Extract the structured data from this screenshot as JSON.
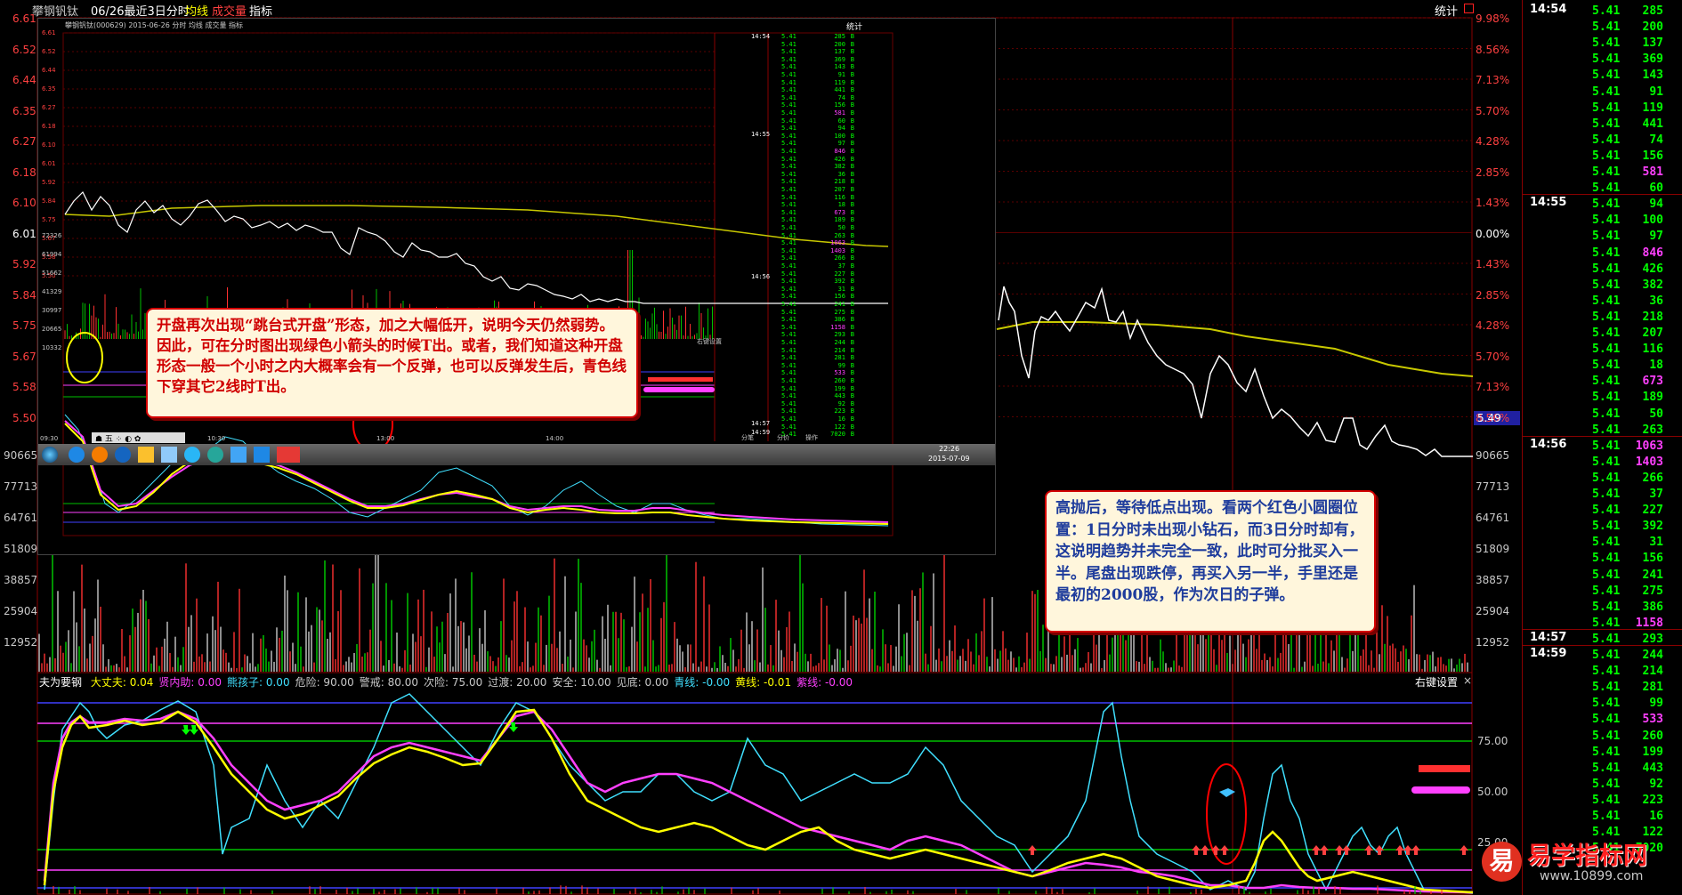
{
  "titlebar": {
    "stock_name": "攀钢钒钛",
    "period": "06/26最近3日分时",
    "ma_label": "均线",
    "vol_label": "成交量",
    "indicator_label": "指标",
    "stats_label": "统计"
  },
  "left_axis": [
    "6.61",
    "6.52",
    "6.44",
    "6.35",
    "6.27",
    "6.18",
    "6.10",
    "6.01",
    "5.92",
    "5.84",
    "5.75",
    "5.67",
    "5.58",
    "5.50"
  ],
  "left_vol_axis": [
    "90665",
    "77713",
    "64761",
    "51809",
    "38857",
    "25904",
    "12952"
  ],
  "right_axis": [
    "9.98%",
    "8.56%",
    "7.13%",
    "5.70%",
    "4.28%",
    "2.85%",
    "1.43%",
    "0.00%",
    "1.43%",
    "2.85%",
    "4.28%",
    "5.70%",
    "7.13%",
    "8.56%"
  ],
  "right_vol_axis": [
    "90665",
    "77713",
    "64761",
    "51809",
    "38857",
    "25904",
    "12952"
  ],
  "current_price_tag": "5.49",
  "right_indicator_axis": [
    "75.00",
    "50.00",
    "25.00"
  ],
  "indicator_bar": {
    "name": "夫为要钢",
    "items": [
      {
        "label": "大丈夫:",
        "value": "0.04",
        "color": "#ffff00"
      },
      {
        "label": "贤内助:",
        "value": "0.00",
        "color": "#ff40ff"
      },
      {
        "label": "熊孩子:",
        "value": "0.00",
        "color": "#40e0ff"
      },
      {
        "label": "危险:",
        "value": "90.00",
        "color": "#c8c8c8"
      },
      {
        "label": "警戒:",
        "value": "80.00",
        "color": "#c8c8c8"
      },
      {
        "label": "次险:",
        "value": "75.00",
        "color": "#c8c8c8"
      },
      {
        "label": "过渡:",
        "value": "20.00",
        "color": "#c8c8c8"
      },
      {
        "label": "安全:",
        "value": "10.00",
        "color": "#c8c8c8"
      },
      {
        "label": "见底:",
        "value": "0.00",
        "color": "#c8c8c8"
      },
      {
        "label": "青线:",
        "value": "-0.00",
        "color": "#40e0ff"
      },
      {
        "label": "黄线:",
        "value": "-0.01",
        "color": "#ffff00"
      },
      {
        "label": "紫线:",
        "value": "-0.00",
        "color": "#ff40ff"
      }
    ],
    "settings_label": "右键设置",
    "close_label": "×"
  },
  "callout1": "开盘再次出现“跳台式开盘”形态，加之大幅低开，说明今天仍然弱势。因此，可在分时图出现绿色小箭头的时候T出。或者，我们知道这种开盘形态一般一个小时之内大概率会有一个反弹，也可以反弹发生后，青色线下穿其它2线时T出。",
  "callout2": "高抛后，等待低点出现。看两个红色小圆圈位置：1日分时未出现小钻石，而3日分时却有，这说明趋势并未完全一致，此时可分批买入一半。尾盘出现跌停，再买入另一半，手里还是最初的2000股，作为次日的子弹。",
  "inset": {
    "title_text": "攀钢钒钛(000629) 2015-06-26 分时 均线 成交量 指标",
    "stats_label": "统计",
    "axis": [
      "6.61",
      "6.52",
      "6.44",
      "6.35",
      "6.27",
      "6.18",
      "6.10",
      "6.01",
      "5.92",
      "5.84",
      "5.75",
      "5.67",
      "5.58",
      "5.50"
    ],
    "vol_axis": [
      "72326",
      "61994",
      "51662",
      "41329",
      "30997",
      "20665",
      "10332"
    ],
    "times": [
      "09:30",
      "10:30",
      "13:00",
      "14:00"
    ],
    "ob_times": [
      "14:54",
      "14:55",
      "14:56",
      "14:57",
      "14:59"
    ],
    "tabs": [
      "分笔",
      "分价",
      "操作"
    ],
    "taskbar_time": "22:26",
    "taskbar_date": "2015-07-09",
    "settings_label": "右键设置"
  },
  "order_book": {
    "time_markers": [
      {
        "label": "14:54",
        "row": 0
      },
      {
        "label": "14:55",
        "row": 12
      },
      {
        "label": "14:56",
        "row": 27
      },
      {
        "label": "14:57",
        "row": 39
      },
      {
        "label": "14:59",
        "row": 40
      }
    ],
    "price": "5.41",
    "volumes": [
      {
        "v": "285",
        "c": "#00ff00"
      },
      {
        "v": "200",
        "c": "#00ff00"
      },
      {
        "v": "137",
        "c": "#00ff00"
      },
      {
        "v": "369",
        "c": "#00ff00"
      },
      {
        "v": "143",
        "c": "#00ff00"
      },
      {
        "v": "91",
        "c": "#00ff00"
      },
      {
        "v": "119",
        "c": "#00ff00"
      },
      {
        "v": "441",
        "c": "#00ff00"
      },
      {
        "v": "74",
        "c": "#00ff00"
      },
      {
        "v": "156",
        "c": "#00ff00"
      },
      {
        "v": "581",
        "c": "#ff40ff"
      },
      {
        "v": "60",
        "c": "#00ff00"
      },
      {
        "v": "94",
        "c": "#00ff00"
      },
      {
        "v": "100",
        "c": "#00ff00"
      },
      {
        "v": "97",
        "c": "#00ff00"
      },
      {
        "v": "846",
        "c": "#ff40ff"
      },
      {
        "v": "426",
        "c": "#00ff00"
      },
      {
        "v": "382",
        "c": "#00ff00"
      },
      {
        "v": "36",
        "c": "#00ff00"
      },
      {
        "v": "218",
        "c": "#00ff00"
      },
      {
        "v": "207",
        "c": "#00ff00"
      },
      {
        "v": "116",
        "c": "#00ff00"
      },
      {
        "v": "18",
        "c": "#00ff00"
      },
      {
        "v": "673",
        "c": "#ff40ff"
      },
      {
        "v": "189",
        "c": "#00ff00"
      },
      {
        "v": "50",
        "c": "#00ff00"
      },
      {
        "v": "263",
        "c": "#00ff00"
      },
      {
        "v": "1063",
        "c": "#ff40ff"
      },
      {
        "v": "1403",
        "c": "#ff40ff"
      },
      {
        "v": "266",
        "c": "#00ff00"
      },
      {
        "v": "37",
        "c": "#00ff00"
      },
      {
        "v": "227",
        "c": "#00ff00"
      },
      {
        "v": "392",
        "c": "#00ff00"
      },
      {
        "v": "31",
        "c": "#00ff00"
      },
      {
        "v": "156",
        "c": "#00ff00"
      },
      {
        "v": "241",
        "c": "#00ff00"
      },
      {
        "v": "275",
        "c": "#00ff00"
      },
      {
        "v": "386",
        "c": "#00ff00"
      },
      {
        "v": "1158",
        "c": "#ff40ff"
      },
      {
        "v": "293",
        "c": "#00ff00"
      },
      {
        "v": "244",
        "c": "#00ff00"
      },
      {
        "v": "214",
        "c": "#00ff00"
      },
      {
        "v": "281",
        "c": "#00ff00"
      },
      {
        "v": "99",
        "c": "#00ff00"
      },
      {
        "v": "533",
        "c": "#ff40ff"
      },
      {
        "v": "260",
        "c": "#00ff00"
      },
      {
        "v": "199",
        "c": "#00ff00"
      },
      {
        "v": "443",
        "c": "#00ff00"
      },
      {
        "v": "92",
        "c": "#00ff00"
      },
      {
        "v": "223",
        "c": "#00ff00"
      },
      {
        "v": "16",
        "c": "#00ff00"
      },
      {
        "v": "122",
        "c": "#00ff00"
      },
      {
        "v": "7020",
        "c": "#00ff00"
      }
    ]
  },
  "watermark": {
    "logo_char": "易",
    "text": "易学指标网",
    "url": "www.10899.com"
  },
  "colors": {
    "price_line": "#ffffff",
    "avg_line": "#c8c800",
    "up": "#ff3030",
    "down": "#00d000",
    "cyan": "#40e0ff",
    "yellow": "#ffff00",
    "magenta": "#ff40ff",
    "grid_red": "#8a0000"
  }
}
